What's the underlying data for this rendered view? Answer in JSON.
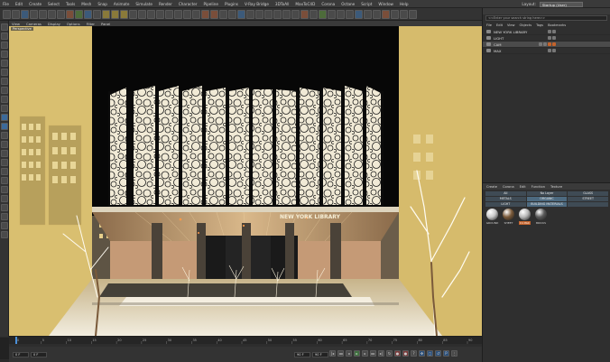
{
  "menubar": {
    "items": [
      "File",
      "Edit",
      "Create",
      "Select",
      "Tools",
      "Mesh",
      "Snap",
      "Animate",
      "Simulate",
      "Render",
      "Character",
      "Pipeline",
      "Plugins",
      "V-Ray Bridge",
      "3DToAll",
      "MaxToC4D",
      "Corona",
      "Octane",
      "Script",
      "Window",
      "Help"
    ],
    "layout_label": "Layout:",
    "layout_value": "Startup (User)"
  },
  "viewport": {
    "menu": [
      "View",
      "Cameras",
      "Display",
      "Options",
      "Filter",
      "Panel"
    ],
    "label": "Perspective"
  },
  "object_manager": {
    "top_label": "",
    "search_placeholder": "<<Enter your search string here>>",
    "tabs": [
      "File",
      "Edit",
      "View",
      "Objects",
      "Tags",
      "Bookmarks"
    ],
    "objects": [
      {
        "name": "NEW YORK LIBRARY",
        "selected": false
      },
      {
        "name": "LIGHT",
        "selected": false
      },
      {
        "name": "CAM",
        "selected": true
      },
      {
        "name": "MAX",
        "selected": false
      }
    ]
  },
  "material_manager": {
    "menu": [
      "Create",
      "Corona",
      "Edit",
      "Function",
      "Texture"
    ],
    "layers": [
      {
        "label": "All",
        "hl": false
      },
      {
        "label": "No Layer",
        "hl": false
      },
      {
        "label": "GLASS",
        "hl": false
      },
      {
        "label": "METALS",
        "hl": false
      },
      {
        "label": "ORGANIC",
        "hl": true
      },
      {
        "label": "STREET",
        "hl": false
      },
      {
        "label": "LIGHT",
        "hl": false
      },
      {
        "label": "BUILDING MATERIALS",
        "hl": true
      },
      {
        "label": "",
        "hl": false
      }
    ],
    "materials": [
      {
        "name": "GROUND",
        "color": "#c9c9c9",
        "selected": false
      },
      {
        "name": "SHEET",
        "color": "#7a5a3a",
        "selected": false
      },
      {
        "name": "C1 PAC",
        "color": "#b8b8b8",
        "selected": true
      },
      {
        "name": "BRICKS",
        "color": "#5a5a5a",
        "selected": false
      }
    ]
  },
  "timeline": {
    "ticks": [
      "0",
      "5",
      "10",
      "15",
      "20",
      "25",
      "30",
      "35",
      "40",
      "45",
      "50",
      "55",
      "60",
      "65",
      "70",
      "75",
      "80",
      "85",
      "90"
    ],
    "start_field": "0 F",
    "current_field": "0 F",
    "end_field": "90 F",
    "end_field2": "90 F",
    "frame_readout": "0 F"
  },
  "colors": {
    "accent": "#c5632b",
    "selection": "#4b4b4b",
    "scene_tint": "#e0c57a",
    "sky": "#080808"
  }
}
